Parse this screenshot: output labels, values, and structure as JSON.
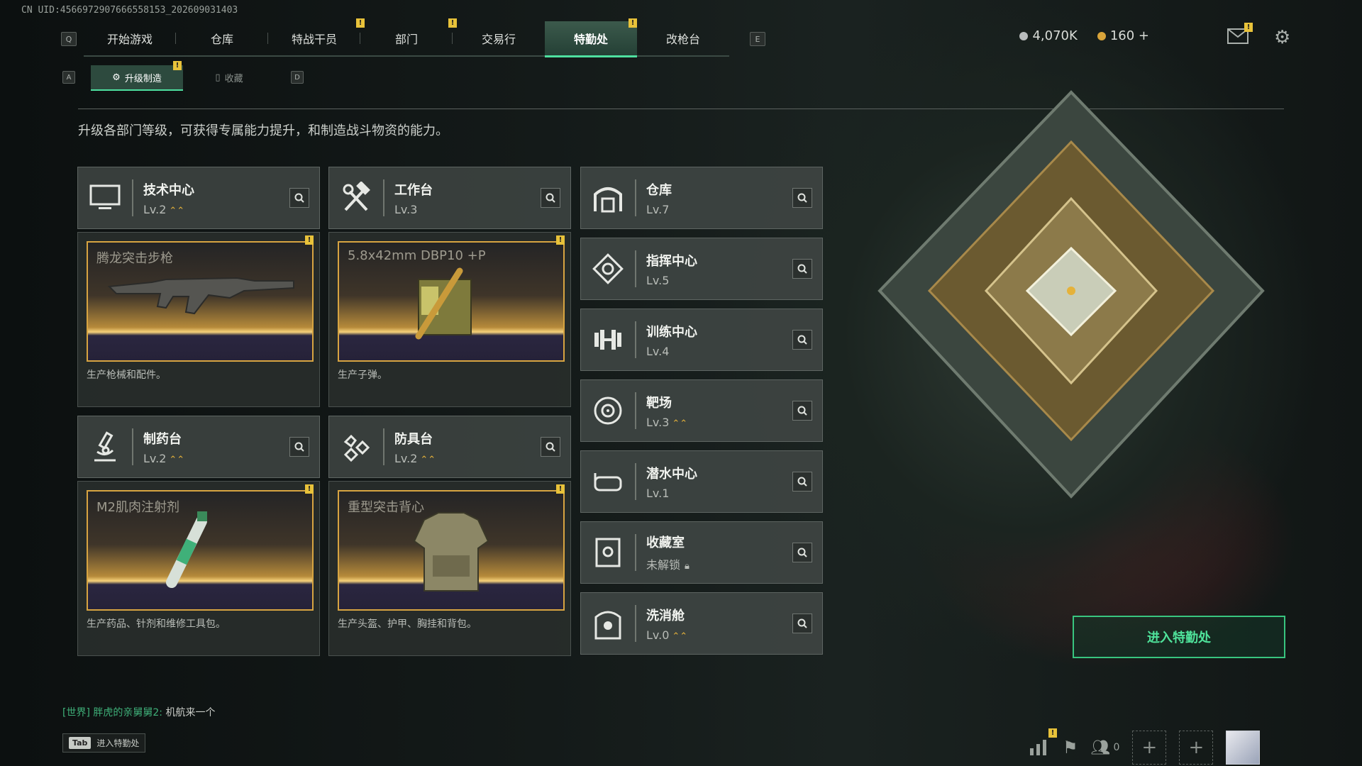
{
  "uid_text": "CN UID:4566972907666558153_202609031403",
  "nav": {
    "key_left": "Q",
    "key_right": "E",
    "tabs": [
      "开始游戏",
      "仓库",
      "特战干员",
      "部门",
      "交易行",
      "特勤处",
      "改枪台"
    ],
    "active_tab": "特勤处"
  },
  "subnav": {
    "key_left": "A",
    "key_right": "D",
    "tabs": [
      "升级制造",
      "收藏"
    ],
    "active": "升级制造"
  },
  "currency": {
    "silver": "4,070K",
    "gold": "160",
    "plus": "+",
    "colors": {
      "silver": "#b9bcbd",
      "gold": "#d9a43a"
    }
  },
  "description": "升级各部门等级，可获得专属能力提升，和制造战斗物资的能力。",
  "production_departments": [
    {
      "name": "技术中心",
      "level": "Lv.2",
      "upgradable": true,
      "icon": "monitor-icon",
      "product": "腾龙突击步枪",
      "product_desc": "生产枪械和配件。"
    },
    {
      "name": "工作台",
      "level": "Lv.3",
      "upgradable": false,
      "icon": "hammer-wrench-icon",
      "product": "5.8x42mm DBP10 +P",
      "product_desc": "生产子弹。"
    },
    {
      "name": "制药台",
      "level": "Lv.2",
      "upgradable": true,
      "icon": "microscope-icon",
      "product": "M2肌肉注射剂",
      "product_desc": "生产药品、针剂和维修工具包。"
    },
    {
      "name": "防具台",
      "level": "Lv.2",
      "upgradable": true,
      "icon": "armor-icon",
      "product": "重型突击背心",
      "product_desc": "生产头盔、护甲、胸挂和背包。"
    }
  ],
  "other_departments": [
    {
      "name": "仓库",
      "level": "Lv.7",
      "upgradable": false,
      "icon": "warehouse-icon"
    },
    {
      "name": "指挥中心",
      "level": "Lv.5",
      "upgradable": false,
      "icon": "command-icon"
    },
    {
      "name": "训练中心",
      "level": "Lv.4",
      "upgradable": false,
      "icon": "dumbbell-icon"
    },
    {
      "name": "靶场",
      "level": "Lv.3",
      "upgradable": true,
      "icon": "target-icon"
    },
    {
      "name": "潜水中心",
      "level": "Lv.1",
      "upgradable": false,
      "icon": "diving-mask-icon"
    },
    {
      "name": "收藏室",
      "level": "未解锁",
      "upgradable": false,
      "locked": true,
      "icon": "collection-icon"
    },
    {
      "name": "洗消舱",
      "level": "Lv.0",
      "upgradable": true,
      "icon": "decon-icon"
    }
  ],
  "enter_button": "进入特勤处",
  "chat": {
    "channel": "[世界]",
    "user": "胖虎的亲舅舅2:",
    "message": "机航来一个"
  },
  "tab_hint": {
    "key": "Tab",
    "label": "进入特勤处"
  },
  "friends_count": "0",
  "notif_mark": "!"
}
